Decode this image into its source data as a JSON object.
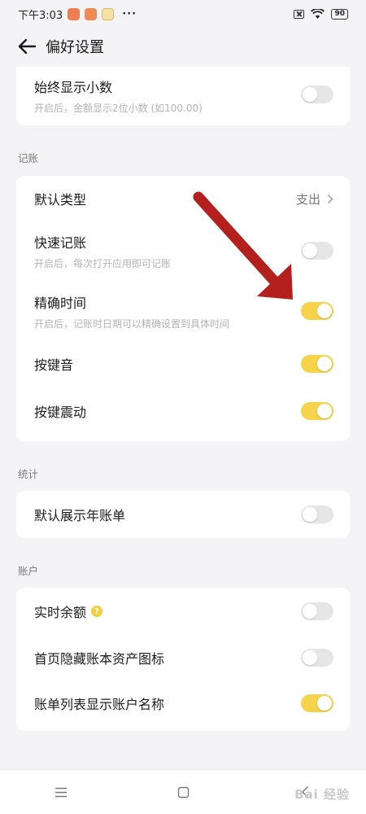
{
  "status_bar": {
    "time": "下午3:03",
    "dots": "···",
    "battery": "90"
  },
  "header": {
    "title": "偏好设置"
  },
  "sections": {
    "top": {
      "always_decimal": {
        "title": "始终显示小数",
        "desc": "开启后，金额显示2位小数 (如100.00)",
        "on": false
      }
    },
    "bookkeeping": {
      "label": "记账",
      "default_type": {
        "title": "默认类型",
        "value": "支出"
      },
      "quick_entry": {
        "title": "快速记账",
        "desc": "开启后，每次打开应用即可记账",
        "on": false
      },
      "precise_time": {
        "title": "精确时间",
        "desc": "开启后，记账时日期可以精确设置到具体时间",
        "on": true
      },
      "key_sound": {
        "title": "按键音",
        "on": true
      },
      "key_vibration": {
        "title": "按键震动",
        "on": true
      }
    },
    "statistics": {
      "label": "统计",
      "default_year_bill": {
        "title": "默认展示年账单",
        "on": false
      }
    },
    "account": {
      "label": "账户",
      "realtime_balance": {
        "title": "实时余额",
        "help": "?",
        "on": false
      },
      "hide_asset_icon": {
        "title": "首页隐藏账本资产图标",
        "on": false
      },
      "show_account_name": {
        "title": "账单列表显示账户名称",
        "on": true
      }
    }
  },
  "watermark": "Bai 经验",
  "colors": {
    "toggle_on": "#f5d34a",
    "toggle_off": "#e6e6e6",
    "arrow": "#b3201e"
  }
}
